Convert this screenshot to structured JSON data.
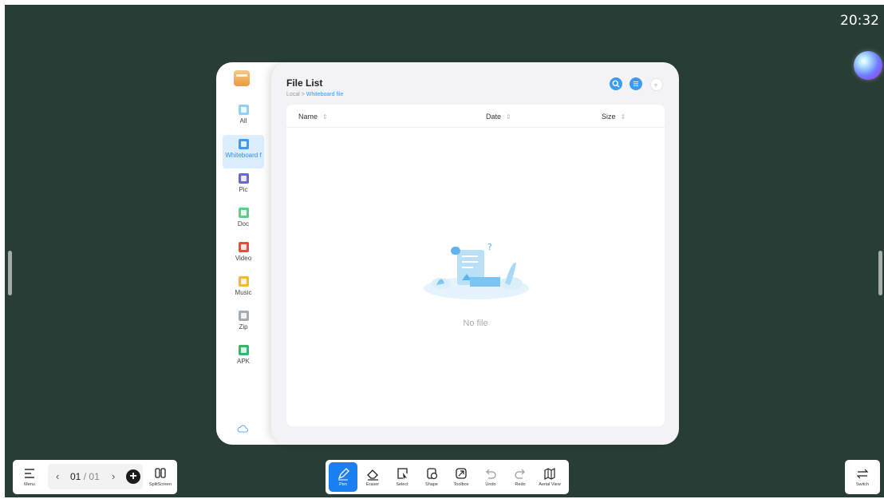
{
  "clock": "20:32",
  "file_manager": {
    "title": "File List",
    "breadcrumb": {
      "root": "Local",
      "separator": ">",
      "current": "Whiteboard file"
    },
    "categories": [
      {
        "label": "All",
        "icon": "grid-icon",
        "color": "#8fd2f5"
      },
      {
        "label": "Whiteboard f",
        "icon": "whiteboard-icon",
        "color": "#3b9bf5"
      },
      {
        "label": "Pic",
        "icon": "picture-icon",
        "color": "#6b63e8"
      },
      {
        "label": "Doc",
        "icon": "document-icon",
        "color": "#5ccf8a"
      },
      {
        "label": "Video",
        "icon": "video-icon",
        "color": "#ec4a3a"
      },
      {
        "label": "Music",
        "icon": "music-icon",
        "color": "#f5b82e"
      },
      {
        "label": "Zip",
        "icon": "zip-icon",
        "color": "#a5adb6"
      },
      {
        "label": "APK",
        "icon": "android-icon",
        "color": "#2fb96a"
      }
    ],
    "active_category": "Whiteboard f",
    "columns": [
      {
        "label": "Name"
      },
      {
        "label": "Date"
      },
      {
        "label": "Size"
      }
    ],
    "empty_text": "No file"
  },
  "bottom_left": {
    "menu_label": "Menu",
    "page_current": "01",
    "page_separator": "/",
    "page_total": "01",
    "splitscreen_label": "SplitScreen"
  },
  "toolbar": {
    "tools": [
      {
        "label": "Pen",
        "icon": "pen-icon",
        "active": true
      },
      {
        "label": "Eraser",
        "icon": "eraser-icon"
      },
      {
        "label": "Select",
        "icon": "select-icon"
      },
      {
        "label": "Shape",
        "icon": "shape-icon"
      },
      {
        "label": "Toolbox",
        "icon": "toolbox-icon"
      },
      {
        "label": "Undo",
        "icon": "undo-icon"
      },
      {
        "label": "Redo",
        "icon": "redo-icon"
      },
      {
        "label": "Aerial View",
        "icon": "map-icon"
      }
    ]
  },
  "bottom_right": {
    "switch_label": "Switch"
  },
  "colors": {
    "board": "#283d36",
    "accent": "#1a7ff0",
    "link": "#3b9bf5"
  }
}
